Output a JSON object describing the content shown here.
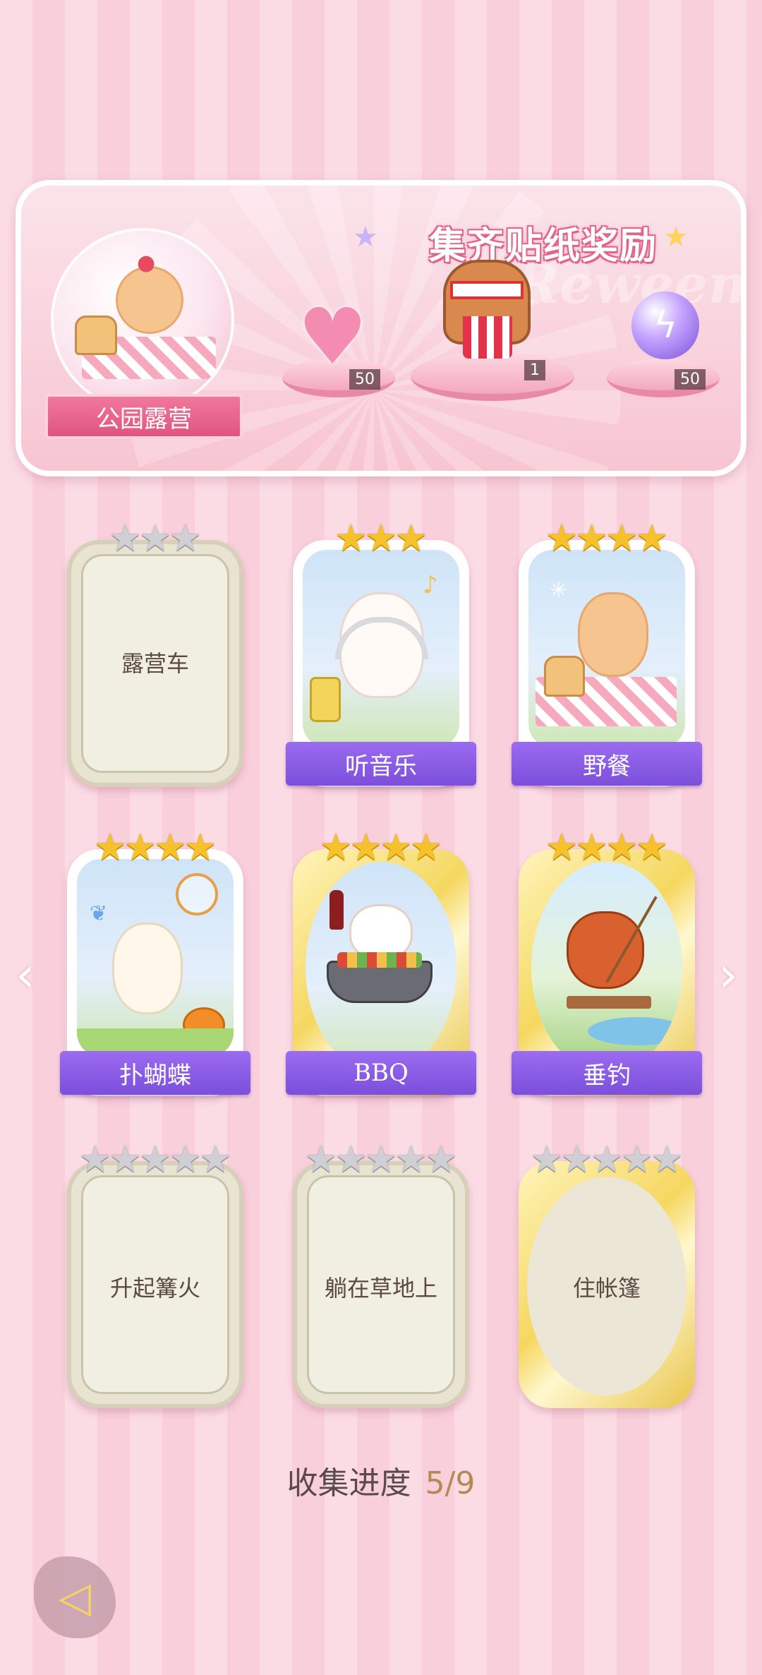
{
  "banner": {
    "title": "集齐贴纸奖励",
    "watermark": "Reweem",
    "theme_label": "公园露营",
    "rewards": [
      {
        "name": "pink-heart-gem",
        "count": "50"
      },
      {
        "name": "popcorn-bear-sticker",
        "count": "1"
      },
      {
        "name": "lightning-orb",
        "count": "50"
      }
    ]
  },
  "cards": [
    {
      "label": "露营车",
      "state": "locked",
      "stars": 3,
      "gold_stars": 0,
      "frame": "plain"
    },
    {
      "label": "听音乐",
      "state": "collected",
      "stars": 3,
      "gold_stars": 3,
      "frame": "plain",
      "art": "bunny-with-headphones"
    },
    {
      "label": "野餐",
      "state": "collected",
      "stars": 4,
      "gold_stars": 4,
      "frame": "plain",
      "art": "cat-picnic"
    },
    {
      "label": "扑蝴蝶",
      "state": "collected",
      "stars": 4,
      "gold_stars": 4,
      "frame": "plain",
      "art": "bear-catching-butterfly"
    },
    {
      "label": "BBQ",
      "state": "collected",
      "stars": 4,
      "gold_stars": 4,
      "frame": "gold",
      "art": "cat-bbq"
    },
    {
      "label": "垂钓",
      "state": "collected",
      "stars": 4,
      "gold_stars": 4,
      "frame": "gold",
      "art": "red-panda-fishing"
    },
    {
      "label": "升起篝火",
      "state": "locked",
      "stars": 5,
      "gold_stars": 0,
      "frame": "plain"
    },
    {
      "label": "躺在草地上",
      "state": "locked",
      "stars": 5,
      "gold_stars": 0,
      "frame": "plain"
    },
    {
      "label": "住帐篷",
      "state": "locked",
      "stars": 5,
      "gold_stars": 0,
      "frame": "gold"
    }
  ],
  "progress": {
    "label": "收集进度",
    "value": "5/9",
    "collected": 5,
    "total": 9
  },
  "nav": {
    "prev_icon": "chevron-left-icon",
    "next_icon": "chevron-right-icon",
    "back_icon": "back-arrow-icon"
  },
  "colors": {
    "ribbon": "#8a5ce6",
    "accent_pink": "#e0557f",
    "gold_star": "#f6c12a",
    "grey_star": "#cfcfd4"
  }
}
